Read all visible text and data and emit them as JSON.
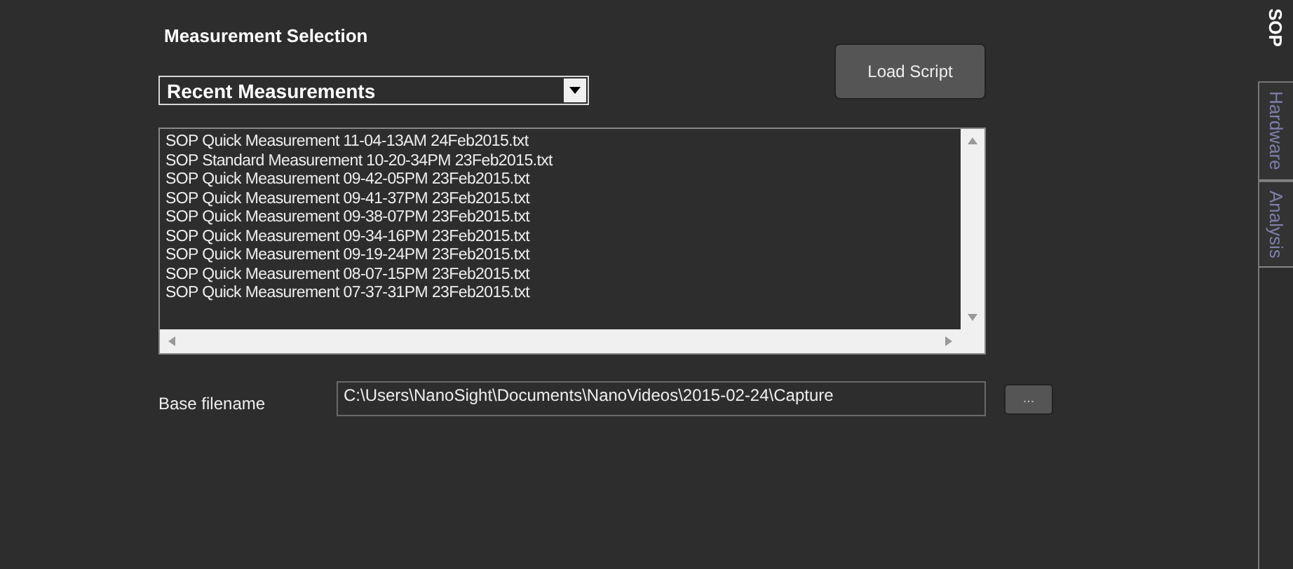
{
  "section_title": "Measurement Selection",
  "dropdown": {
    "value": "Recent Measurements"
  },
  "load_button": "Load Script",
  "files": [
    "SOP Quick Measurement 11-04-13AM 24Feb2015.txt",
    "SOP Standard Measurement 10-20-34PM 23Feb2015.txt",
    "SOP Quick Measurement 09-42-05PM 23Feb2015.txt",
    "SOP Quick Measurement 09-41-37PM 23Feb2015.txt",
    "SOP Quick Measurement 09-38-07PM 23Feb2015.txt",
    "SOP Quick Measurement 09-34-16PM 23Feb2015.txt",
    "SOP Quick Measurement 09-19-24PM 23Feb2015.txt",
    "SOP Quick Measurement 08-07-15PM 23Feb2015.txt",
    "SOP Quick Measurement 07-37-31PM 23Feb2015.txt"
  ],
  "base_filename": {
    "label": "Base filename",
    "value": "C:\\Users\\NanoSight\\Documents\\NanoVideos\\2015-02-24\\Capture",
    "browse": "..."
  },
  "tabs": [
    {
      "label": "SOP",
      "selected": true
    },
    {
      "label": "Hardware",
      "selected": false
    },
    {
      "label": "Analysis",
      "selected": false
    }
  ]
}
